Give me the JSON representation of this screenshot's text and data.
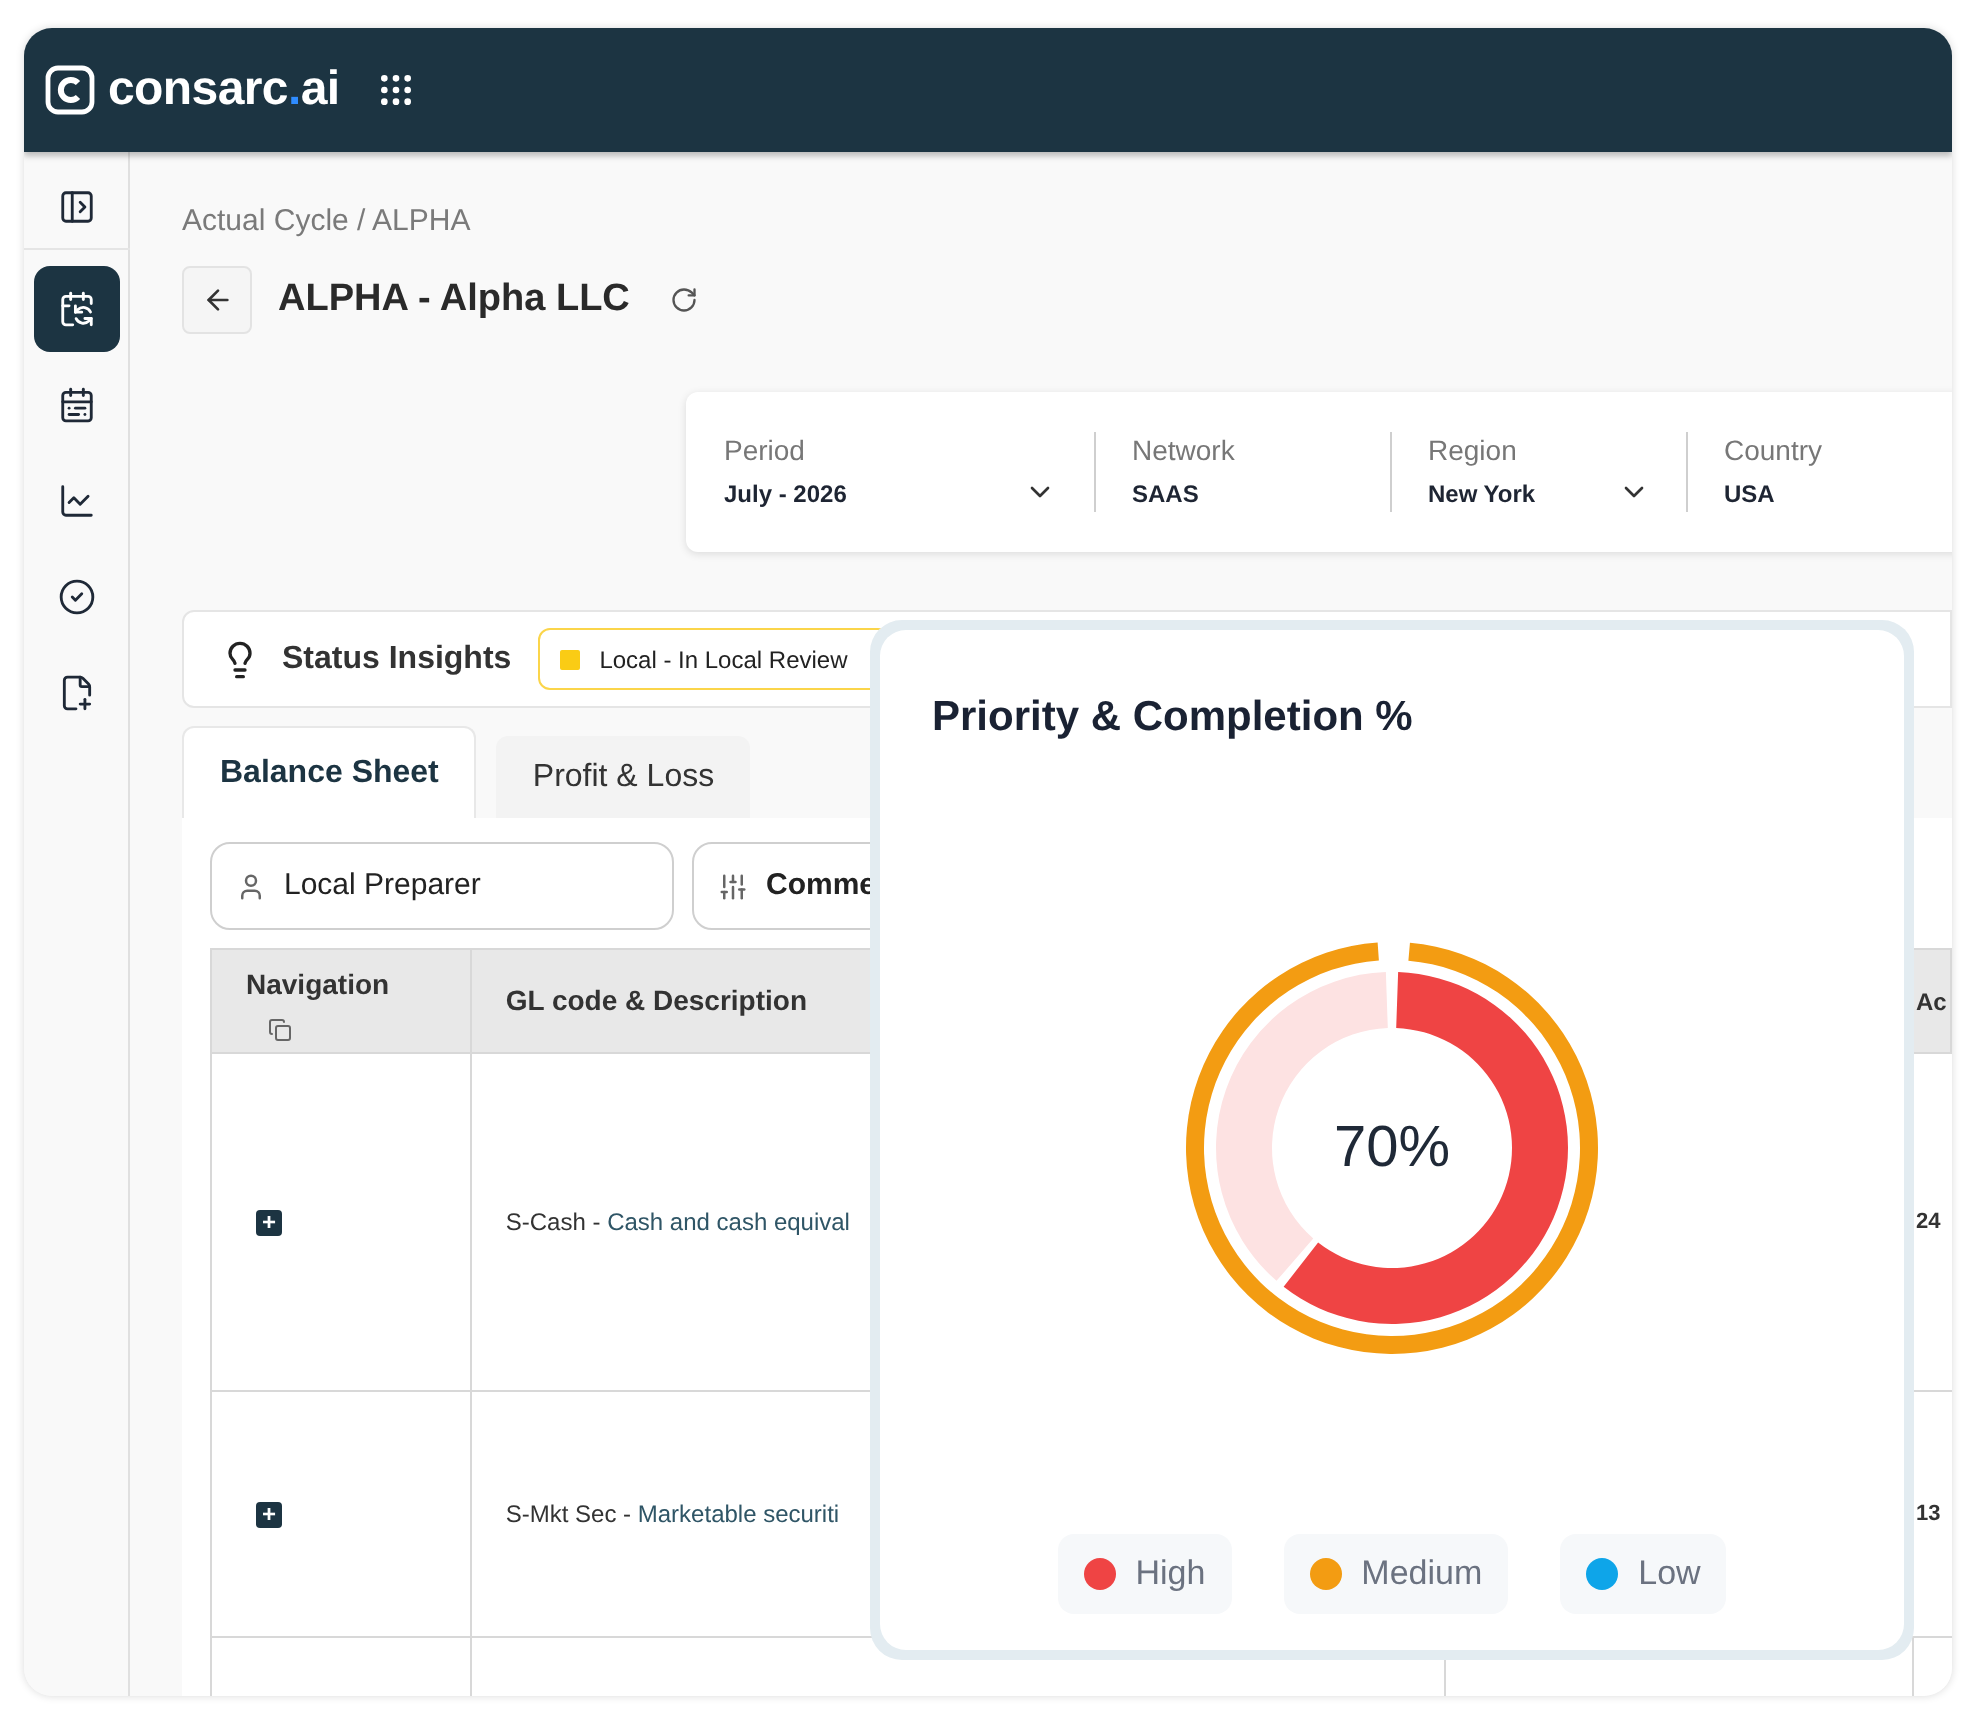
{
  "brand": {
    "text": "consarc",
    "accent": ".",
    "suffix": "ai"
  },
  "sidebar": {
    "items": [
      {
        "kind": "toggle",
        "selected": false
      },
      {
        "kind": "calendar-sync",
        "selected": true
      },
      {
        "kind": "calendar-chart",
        "selected": false
      },
      {
        "kind": "chart",
        "selected": false
      },
      {
        "kind": "check",
        "selected": false
      },
      {
        "kind": "file",
        "selected": false
      }
    ]
  },
  "breadcrumb": "Actual Cycle / ALPHA",
  "title": "ALPHA - Alpha LLC",
  "filters": [
    {
      "label": "Period",
      "value": "July - 2026",
      "kind": "dropdown"
    },
    {
      "label": "Network",
      "value": "SAAS",
      "kind": "text"
    },
    {
      "label": "Region",
      "value": "New York",
      "kind": "dropdown"
    },
    {
      "label": "Country",
      "value": "USA",
      "kind": "text"
    }
  ],
  "status_insights": {
    "label": "Status Insights",
    "badge": {
      "text": "Local - In Local Review",
      "color": "#facc15"
    }
  },
  "tabs": [
    {
      "label": "Balance Sheet",
      "selected": true
    },
    {
      "label": "Profit & Loss",
      "selected": false
    }
  ],
  "table_filters": [
    {
      "kind": "person",
      "text": "Local Preparer"
    },
    {
      "kind": "sliders",
      "text": "Comme"
    }
  ],
  "table": {
    "columns": [
      "Navigation",
      "GL code & Description",
      "",
      "Ac"
    ],
    "rows": [
      {
        "expand": "+",
        "code": "S-Cash -",
        "description": "Cash and cash equival",
        "column_4": "24"
      },
      {
        "expand": "+",
        "code": "S-Mkt Sec -",
        "description": "Marketable securiti",
        "column_4": "13"
      }
    ]
  },
  "popup": {
    "title": "Priority & Completion %",
    "center_label": "70%",
    "legend": [
      {
        "label": "High",
        "color": "#ef4444"
      },
      {
        "label": "Medium",
        "color": "#f39c12"
      },
      {
        "label": "Low",
        "color": "#0ea5e9"
      }
    ]
  }
}
